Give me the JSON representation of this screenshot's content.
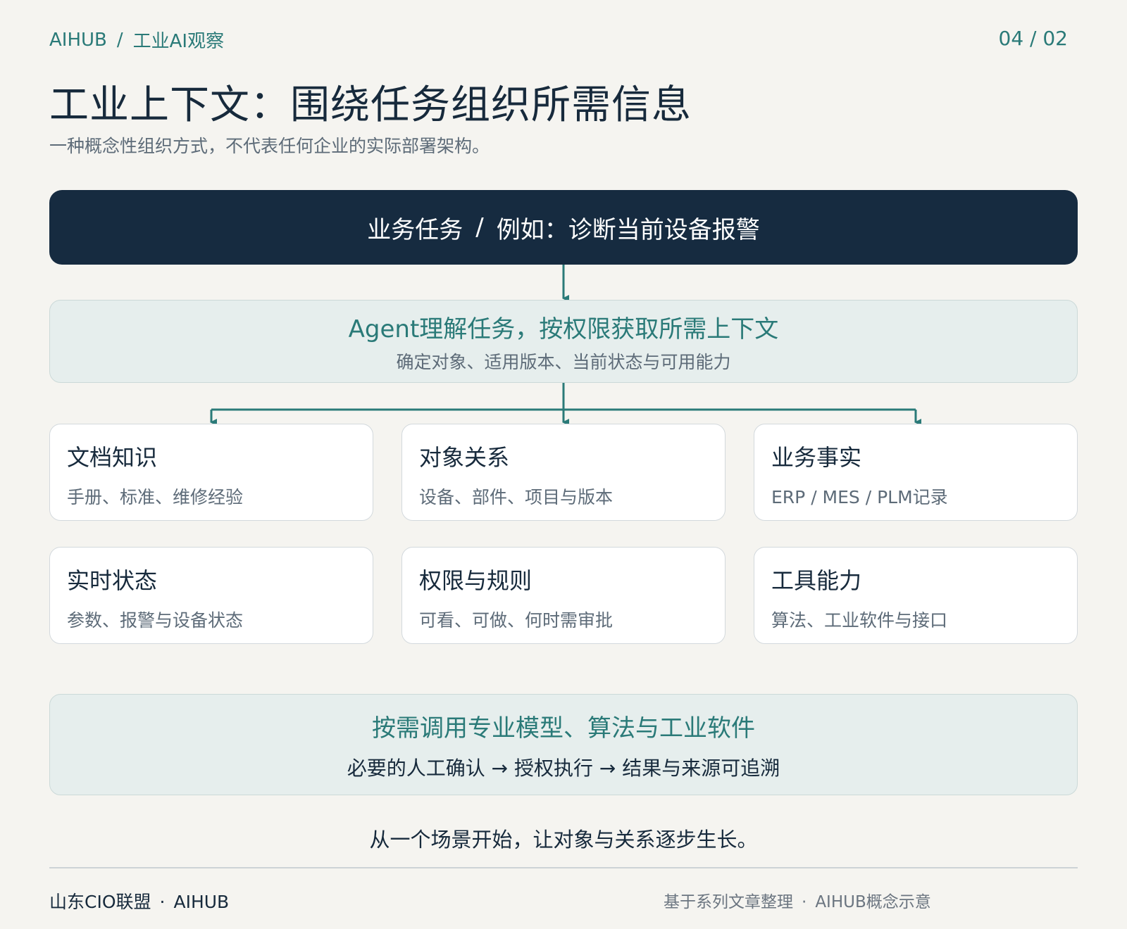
{
  "header": {
    "brand": "AIHUB",
    "separator": "/",
    "section": "工业AI观察",
    "page_indicator": "04 / 02"
  },
  "title": "工业上下文：围绕任务组织所需信息",
  "subtitle": "一种概念性组织方式，不代表任何企业的实际部署架构。",
  "task": {
    "label": "业务任务",
    "separator": "/",
    "example": "例如：诊断当前设备报警"
  },
  "agent": {
    "title": "Agent理解任务，按权限获取所需上下文",
    "subtitle": "确定对象、适用版本、当前状态与可用能力"
  },
  "cards": [
    {
      "title": "文档知识",
      "desc": "手册、标准、维修经验"
    },
    {
      "title": "对象关系",
      "desc": "设备、部件、项目与版本"
    },
    {
      "title": "业务事实",
      "desc": "ERP / MES / PLM记录"
    },
    {
      "title": "实时状态",
      "desc": "参数、报警与设备状态"
    },
    {
      "title": "权限与规则",
      "desc": "可看、可做、何时需审批"
    },
    {
      "title": "工具能力",
      "desc": "算法、工业软件与接口"
    }
  ],
  "invoke": {
    "title": "按需调用专业模型、算法与工业软件",
    "subtitle": "必要的人工确认 → 授权执行 → 结果与来源可追溯"
  },
  "closing": "从一个场景开始，让对象与关系逐步生长。",
  "footer": {
    "org": "山东CIO联盟",
    "org_dot": "·",
    "org_brand": "AIHUB",
    "source": "基于系列文章整理",
    "source_dot": "·",
    "source_note": "AIHUB概念示意"
  },
  "colors": {
    "background": "#f5f4f0",
    "navy": "#162b40",
    "teal": "#2a7a78",
    "panel": "#e6eeed",
    "muted_text": "#5d6b78"
  }
}
